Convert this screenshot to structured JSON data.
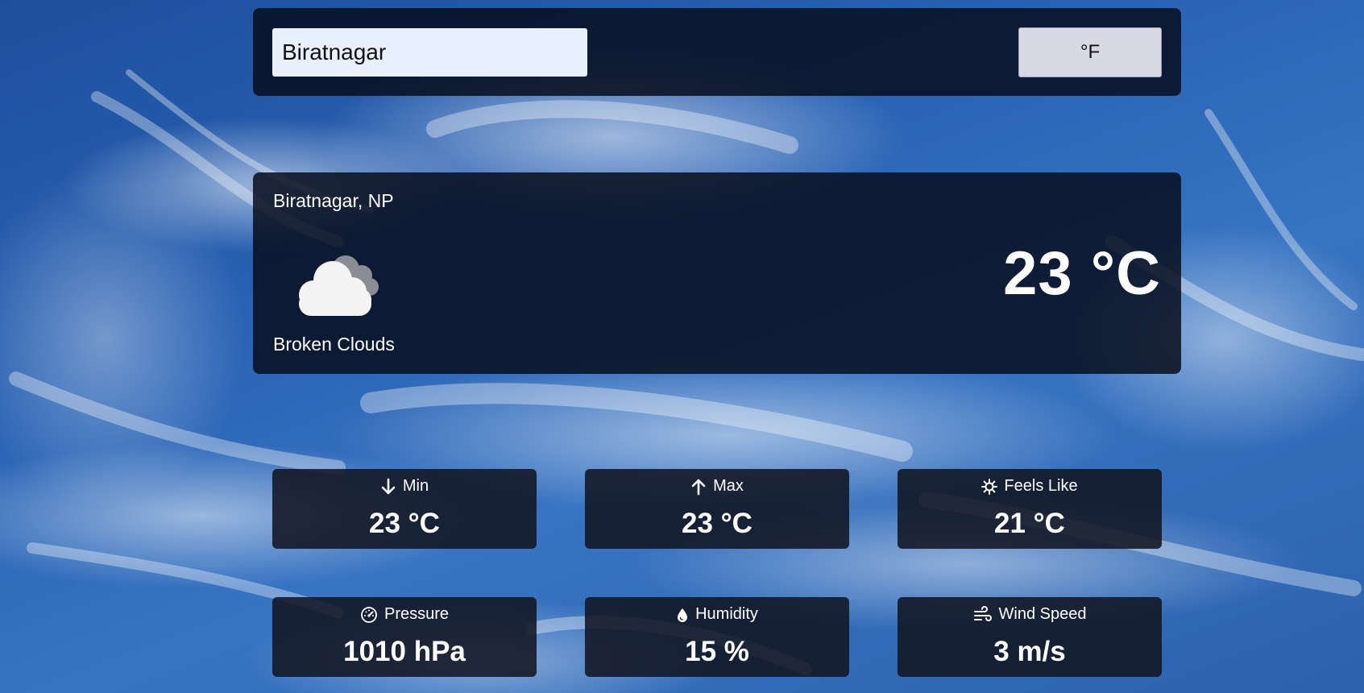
{
  "search": {
    "value": "Biratnagar",
    "unit_toggle_label": "°F"
  },
  "current": {
    "location": "Biratnagar, NP",
    "condition": "Broken Clouds",
    "temperature": "23 °C",
    "icon": "broken-clouds-icon"
  },
  "stats": {
    "min": {
      "label": "Min",
      "value": "23 °C",
      "icon": "arrow-down-icon"
    },
    "max": {
      "label": "Max",
      "value": "23 °C",
      "icon": "arrow-up-icon"
    },
    "feels_like": {
      "label": "Feels Like",
      "value": "21 °C",
      "icon": "sun-icon"
    },
    "pressure": {
      "label": "Pressure",
      "value": "1010 hPa",
      "icon": "gauge-icon"
    },
    "humidity": {
      "label": "Humidity",
      "value": "15 %",
      "icon": "droplet-icon"
    },
    "wind_speed": {
      "label": "Wind Speed",
      "value": "3 m/s",
      "icon": "wind-icon"
    }
  }
}
